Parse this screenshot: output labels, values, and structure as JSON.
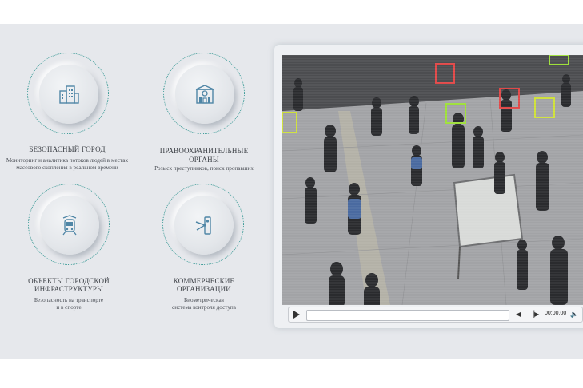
{
  "colors": {
    "accent": "#3a9a96",
    "icon": "#4f86a6",
    "detect_red": "#e04848",
    "detect_green": "#9ee03a",
    "background_band": "#e6e8ec"
  },
  "features": [
    {
      "icon": "city-buildings-icon",
      "title": "БЕЗОПАСНЫЙ ГОРОД",
      "desc_lines": [
        "Мониторинг и аналитика потоков людей в местах",
        "массового скопления в реальном времени"
      ]
    },
    {
      "icon": "police-station-icon",
      "title_lines": [
        "ПРАВООХРАНИТЕЛЬНЫЕ",
        "ОРГАНЫ"
      ],
      "desc_lines": [
        "Розыск преступников, поиск пропавших"
      ]
    },
    {
      "icon": "train-icon",
      "title_lines": [
        "ОБЪЕКТЫ ГОРОДСКОЙ",
        "ИНФРАСТРУКТУРЫ"
      ],
      "desc_lines": [
        "Безопасность на транспорте",
        "и в спорте"
      ]
    },
    {
      "icon": "turnstile-icon",
      "title_lines": [
        "КОММЕРЧЕСКИЕ",
        "ОРГАНИЗАЦИИ"
      ],
      "desc_lines": [
        "Биометрическая",
        "система контроля доступа"
      ]
    }
  ],
  "player": {
    "time": "00:00,00"
  }
}
